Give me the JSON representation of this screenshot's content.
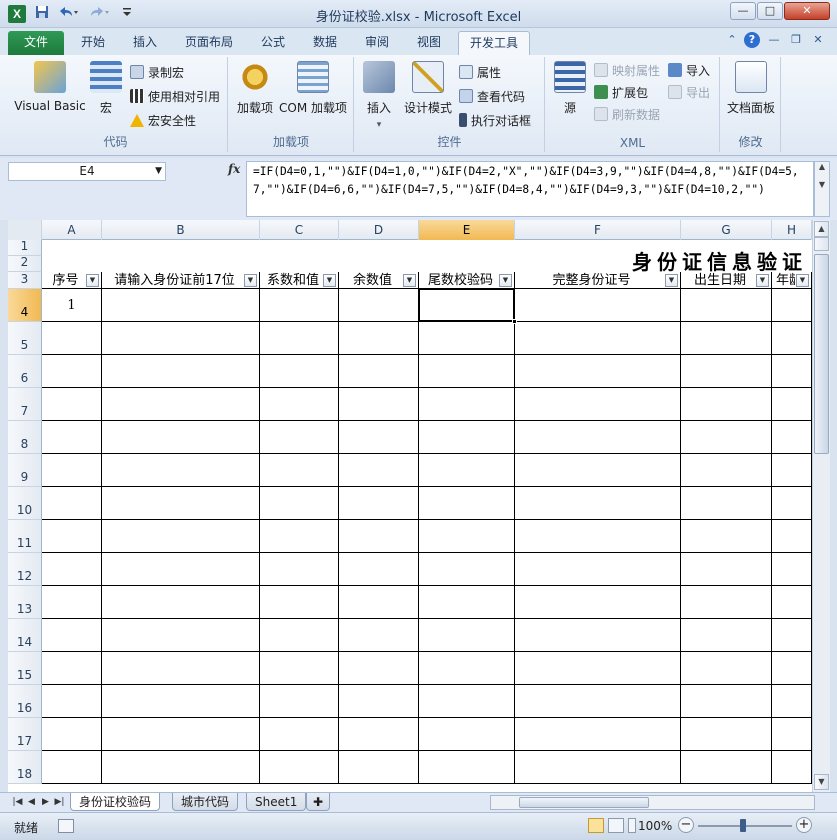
{
  "window": {
    "title": "身份证校验.xlsx - Microsoft Excel",
    "app_icon": "X",
    "quick_access": [
      "save-icon",
      "undo-icon",
      "redo-icon",
      "customize-icon"
    ],
    "controls": {
      "minimize": "—",
      "maximize": "□",
      "close": "✕"
    }
  },
  "tabs": [
    "文件",
    "开始",
    "插入",
    "页面布局",
    "公式",
    "数据",
    "审阅",
    "视图",
    "开发工具"
  ],
  "active_tab": "开发工具",
  "ribbon": {
    "code": {
      "label": "代码",
      "visual_basic": "Visual Basic",
      "macros": "宏",
      "record_macro": "录制宏",
      "relative_ref": "使用相对引用",
      "macro_security": "宏安全性"
    },
    "addins": {
      "label": "加载项",
      "addins": "加载项",
      "com_addins": "COM 加载项"
    },
    "controls": {
      "label": "控件",
      "insert": "插入",
      "design_mode": "设计模式",
      "properties": "属性",
      "view_code": "查看代码",
      "run_dialog": "执行对话框"
    },
    "xml": {
      "label": "XML",
      "source": "源",
      "map_properties": "映射属性",
      "expansion_packs": "扩展包",
      "refresh_data": "刷新数据",
      "import": "导入",
      "export": "导出"
    },
    "modify": {
      "label": "修改",
      "document_panel": "文档面板"
    }
  },
  "formula_bar": {
    "name_box": "E4",
    "fx": "fx",
    "formula": "=IF(D4=0,1,\"\")&IF(D4=1,0,\"\")&IF(D4=2,\"X\",\"\")&IF(D4=3,9,\"\")&IF(D4=4,8,\"\")&IF(D4=5,7,\"\")&IF(D4=6,6,\"\")&IF(D4=7,5,\"\")&IF(D4=8,4,\"\")&IF(D4=9,3,\"\")&IF(D4=10,2,\"\")"
  },
  "sheet": {
    "columns": [
      "A",
      "B",
      "C",
      "D",
      "E",
      "F",
      "G",
      "H"
    ],
    "selected_column": "E",
    "rows": [
      "1",
      "2",
      "3",
      "4",
      "5",
      "6",
      "7",
      "8",
      "9",
      "10",
      "11",
      "12",
      "13",
      "14",
      "15",
      "16",
      "17",
      "18"
    ],
    "selected_row": "4",
    "title": "身份证信息验证",
    "headers": [
      "序号",
      "请输入身份证前17位",
      "系数和值",
      "余数值",
      "尾数校验码",
      "完整身份证号",
      "出生日期",
      "年龄"
    ],
    "a4_value": "1",
    "selected_cell": "E4"
  },
  "sheet_tabs": [
    "身份证校验码",
    "城市代码",
    "Sheet1"
  ],
  "active_sheet": "身份证校验码",
  "status": {
    "ready": "就绪",
    "zoom": "100%"
  }
}
